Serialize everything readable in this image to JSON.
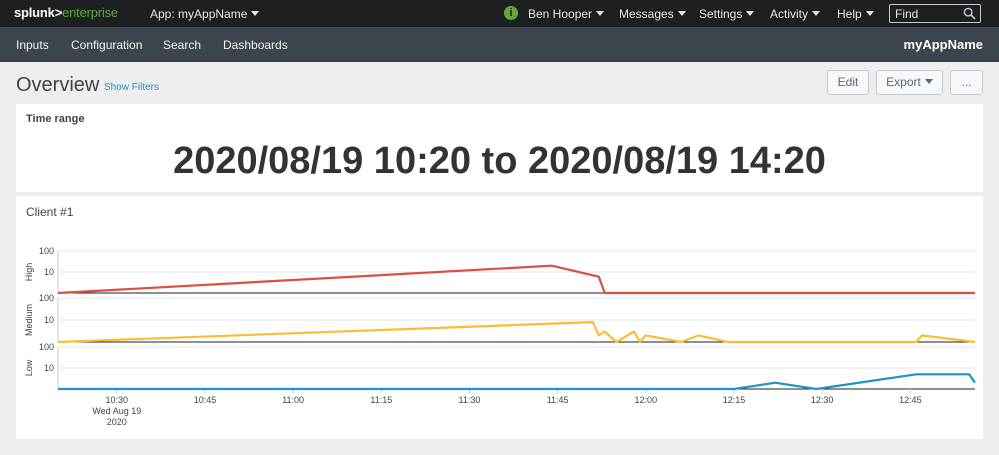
{
  "topbar": {
    "logo_part1": "splunk>",
    "logo_part2": "enterprise",
    "app_menu": "App: myAppName",
    "menus": [
      "Ben Hooper",
      "Messages",
      "Settings",
      "Activity",
      "Help"
    ],
    "find_placeholder": "Find",
    "status_icon": "info-icon",
    "colors": {
      "bar": "#1d1f21",
      "status": "#65a637"
    }
  },
  "navbar": {
    "items": [
      "Inputs",
      "Configuration",
      "Search",
      "Dashboards"
    ],
    "app_name": "myAppName"
  },
  "dashboard": {
    "title": "Overview",
    "show_filters": "Show Filters",
    "edit_label": "Edit",
    "export_label": "Export",
    "more_label": "..."
  },
  "time_panel": {
    "title": "Time range",
    "value": "2020/08/19 10:20 to 2020/08/19 14:20"
  },
  "chart_panel": {
    "title": "Client #1"
  },
  "chart_data": {
    "type": "line",
    "title": "Client #1",
    "y_scale": "log",
    "y_ticks": [
      "100",
      "10"
    ],
    "x_ticks": [
      "10:30",
      "10:45",
      "11:00",
      "11:15",
      "11:30",
      "11:45",
      "12:00",
      "12:15",
      "12:30",
      "12:45"
    ],
    "x_tick_sub": [
      "Wed Aug 19",
      "2020"
    ],
    "x_range": [
      "10:20",
      "12:56"
    ],
    "series": [
      {
        "name": "High",
        "color": "#dc4e41",
        "x": [
          "10:20",
          "11:44",
          "11:52",
          "11:53",
          "12:56"
        ],
        "y": [
          1,
          20,
          6,
          1,
          1
        ]
      },
      {
        "name": "Medium",
        "color": "#f8be34",
        "x": [
          "10:20",
          "11:51",
          "11:52",
          "11:53",
          "11:55",
          "11:58",
          "11:59",
          "12:00",
          "12:06",
          "12:09",
          "12:14",
          "12:46",
          "12:47",
          "12:56"
        ],
        "y": [
          1,
          8,
          2,
          3,
          1,
          3,
          1,
          2,
          1,
          2,
          1,
          1,
          2,
          1
        ]
      },
      {
        "name": "Low",
        "color": "#1e93c6",
        "x": [
          "10:20",
          "12:15",
          "12:22",
          "12:29",
          "12:46",
          "12:55",
          "12:56"
        ],
        "y": [
          1,
          1,
          2,
          1,
          5,
          5,
          2
        ]
      }
    ],
    "grid": true,
    "legend": "none"
  }
}
